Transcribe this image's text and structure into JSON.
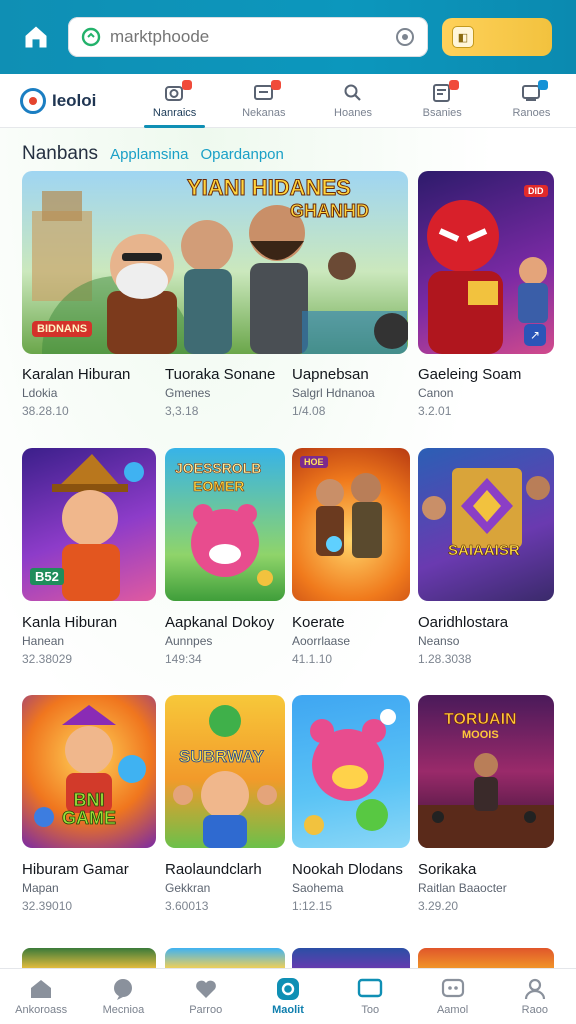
{
  "header": {
    "search_placeholder": "marktphoode",
    "accent": "#0f8fb4",
    "wallet_color": "#f2c23e"
  },
  "brand": {
    "name": "Ieoloi"
  },
  "tabs": [
    {
      "label": "Nanraics",
      "icon": "camera-icon",
      "active": true
    },
    {
      "label": "Nekanas",
      "icon": "message-icon",
      "active": false
    },
    {
      "label": "Hoanes",
      "icon": "search-icon",
      "active": false
    },
    {
      "label": "Bsanies",
      "icon": "document-icon",
      "active": false
    },
    {
      "label": "Ranoes",
      "icon": "download-icon",
      "active": false
    }
  ],
  "section": {
    "heading": "Nanbans",
    "filters": [
      "Applamsina",
      "Opardanpon"
    ]
  },
  "apps": [
    {
      "title": "Karalan Hiburan",
      "subtitle": "Ldokia",
      "meta": "38.28.10",
      "art_text": "YIANI HIDANES",
      "art_text2": "GHANHD",
      "art_badge": "BIDNANS"
    },
    {
      "title": "Tuoraka Sonane",
      "subtitle": "Gmenes",
      "meta": "3,3.18"
    },
    {
      "title": "Uapnebsan",
      "subtitle": "Salgrl Hdnanoa",
      "meta": "1/4.08"
    },
    {
      "title": "Gaeleing Soam",
      "subtitle": "Canon",
      "meta": "3.2.01",
      "art_badge": "DID"
    },
    {
      "title": "Kanla Hiburan",
      "subtitle": "Hanean",
      "meta": "32.38029",
      "art_badge": "B52"
    },
    {
      "title": "Aapkanal Dokoy",
      "subtitle": "Aunnpes",
      "meta": "149:34",
      "art_text": "JOESSROLB",
      "art_text2": "EOMER"
    },
    {
      "title": "Koerate",
      "subtitle": "Aoorrlaase",
      "meta": "41.1.10",
      "art_badge": "HOE"
    },
    {
      "title": "Oaridhlostara",
      "subtitle": "Neanso",
      "meta": "1.28.3038",
      "art_text": "SAIAAISR"
    },
    {
      "title": "Hiburam Gamar",
      "subtitle": "Mapan",
      "meta": "32.39010",
      "art_text": "BNI GAME"
    },
    {
      "title": "Raolaundclarh",
      "subtitle": "Gekkran",
      "meta": "3.60013",
      "art_text": "SUBRWAY"
    },
    {
      "title": "Nookah Dlodans",
      "subtitle": "Saohema",
      "meta": "1:12.15"
    },
    {
      "title": "Sorikaka",
      "subtitle": "Raitlan Baaocter",
      "meta": "3.29.20",
      "art_text": "TORUAIN",
      "art_text2": "MOOIS"
    }
  ],
  "bottom_nav": [
    {
      "label": "Ankoroass",
      "icon": "home-icon",
      "active": false
    },
    {
      "label": "Mecnioa",
      "icon": "chat-icon",
      "active": false
    },
    {
      "label": "Parroo",
      "icon": "heart-icon",
      "active": false
    },
    {
      "label": "Maolit",
      "icon": "app-circle-icon",
      "active": true
    },
    {
      "label": "Too",
      "icon": "tv-icon",
      "active": false
    },
    {
      "label": "Aamol",
      "icon": "game-icon",
      "active": false
    },
    {
      "label": "Raoo",
      "icon": "profile-icon",
      "active": false
    }
  ]
}
